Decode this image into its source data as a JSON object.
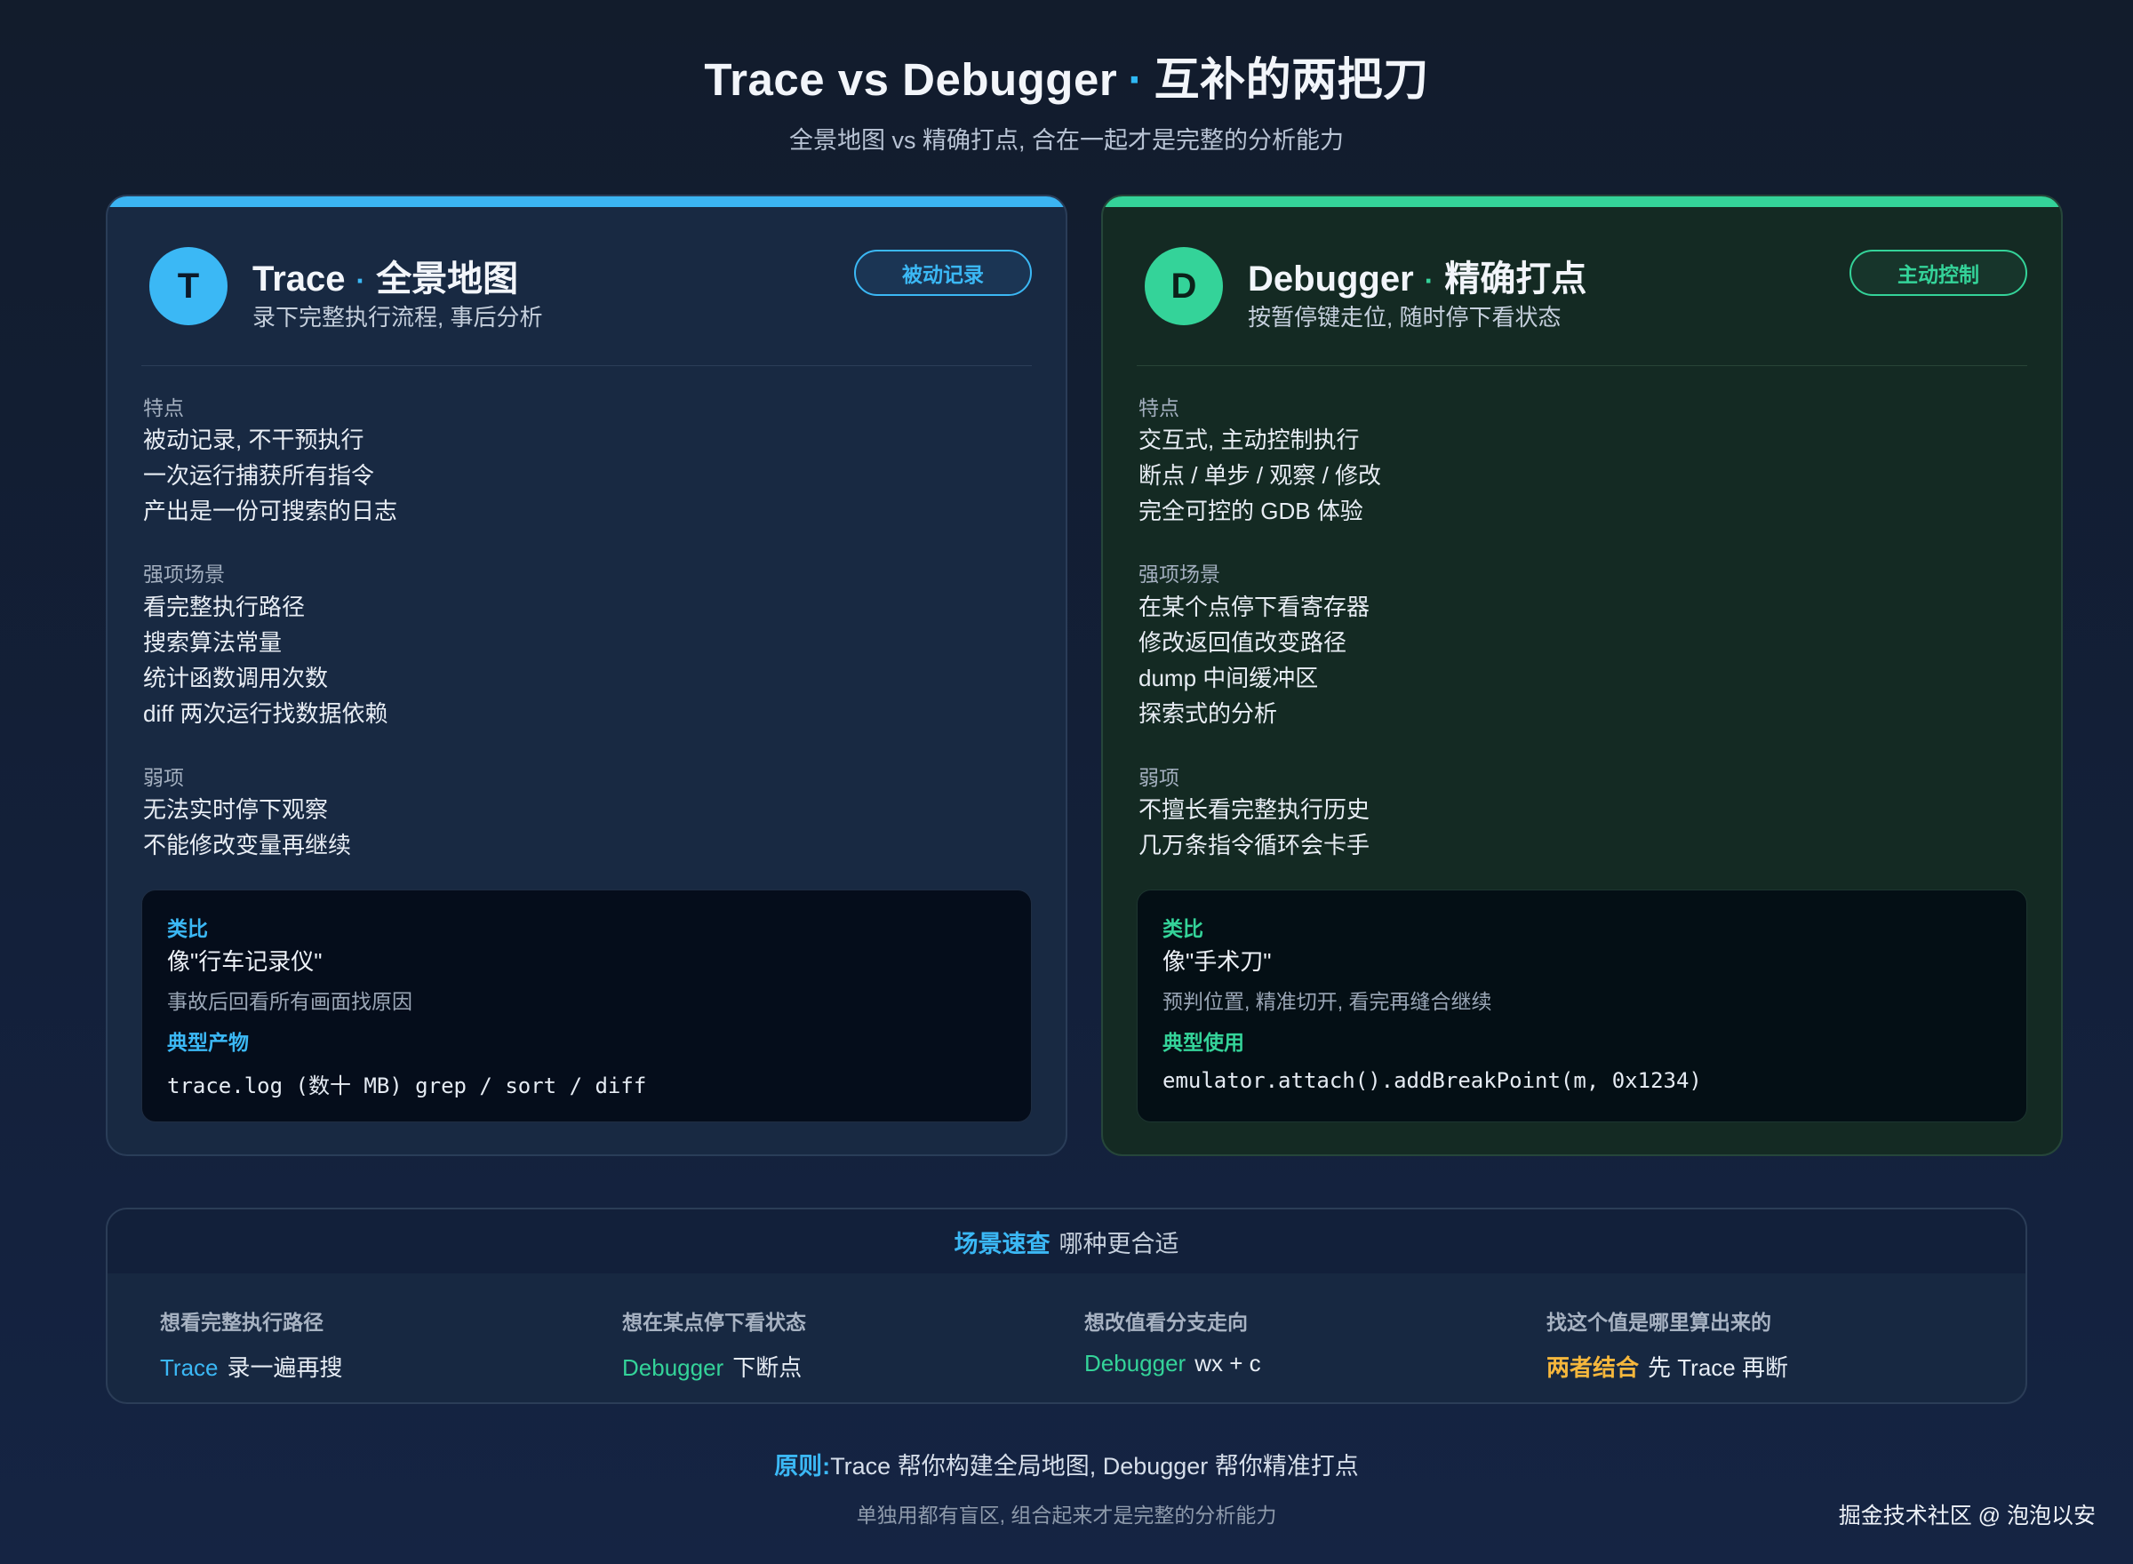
{
  "header": {
    "title_left": "Trace vs Debugger",
    "title_dot": "·",
    "title_right": "互补的两把刀",
    "subtitle": "全景地图 vs 精确打点, 合在一起才是完整的分析能力"
  },
  "colors": {
    "trace_accent": "#3bb8f5",
    "debugger_accent": "#34d399",
    "highlight_yellow": "#f6b73c",
    "background": "#13203a"
  },
  "trace_card": {
    "avatar": "T",
    "name": "Trace",
    "dot": "·",
    "tagline": "全景地图",
    "subtitle": "录下完整执行流程, 事后分析",
    "badge": "被动记录",
    "features_label": "特点",
    "features": [
      "被动记录, 不干预执行",
      "一次运行捕获所有指令",
      "产出是一份可搜索的日志"
    ],
    "strengths_label": "强项场景",
    "strengths": [
      "看完整执行路径",
      "搜索算法常量",
      "统计函数调用次数",
      "diff 两次运行找数据依赖"
    ],
    "weaknesses_label": "弱项",
    "weaknesses": [
      "无法实时停下观察",
      "不能修改变量再继续"
    ],
    "analogy_label": "类比",
    "analogy_main": "像\"行车记录仪\"",
    "analogy_desc": "事故后回看所有画面找原因",
    "output_label": "典型产物",
    "output_code": "trace.log (数十 MB) grep / sort / diff"
  },
  "debugger_card": {
    "avatar": "D",
    "name": "Debugger",
    "dot": "·",
    "tagline": "精确打点",
    "subtitle": "按暂停键走位, 随时停下看状态",
    "badge": "主动控制",
    "features_label": "特点",
    "features": [
      "交互式, 主动控制执行",
      "断点 / 单步 / 观察 / 修改",
      "完全可控的 GDB 体验"
    ],
    "strengths_label": "强项场景",
    "strengths": [
      "在某个点停下看寄存器",
      "修改返回值改变路径",
      "dump 中间缓冲区",
      "探索式的分析"
    ],
    "weaknesses_label": "弱项",
    "weaknesses": [
      "不擅长看完整执行历史",
      "几万条指令循环会卡手"
    ],
    "analogy_label": "类比",
    "analogy_main": "像\"手术刀\"",
    "analogy_desc": "预判位置, 精准切开, 看完再缝合继续",
    "output_label": "典型使用",
    "output_code": "emulator.attach().addBreakPoint(m, 0x1234)"
  },
  "scenarios": {
    "title_highlight": "场景速查",
    "title_rest": "哪种更合适",
    "items": [
      {
        "question": "想看完整执行路径",
        "tool": "Trace",
        "action": "录一遍再搜"
      },
      {
        "question": "想在某点停下看状态",
        "tool": "Debugger",
        "action": "下断点"
      },
      {
        "question": "想改值看分支走向",
        "tool": "Debugger",
        "action": "wx + c"
      },
      {
        "question": "找这个值是哪里算出来的",
        "tool": "两者结合",
        "action": "先 Trace 再断"
      }
    ]
  },
  "footer": {
    "principle_label": "原则:",
    "principle_text": "Trace 帮你构建全局地图, Debugger 帮你精准打点",
    "note": "单独用都有盲区, 组合起来才是完整的分析能力",
    "credit": "掘金技术社区 @ 泡泡以安"
  }
}
